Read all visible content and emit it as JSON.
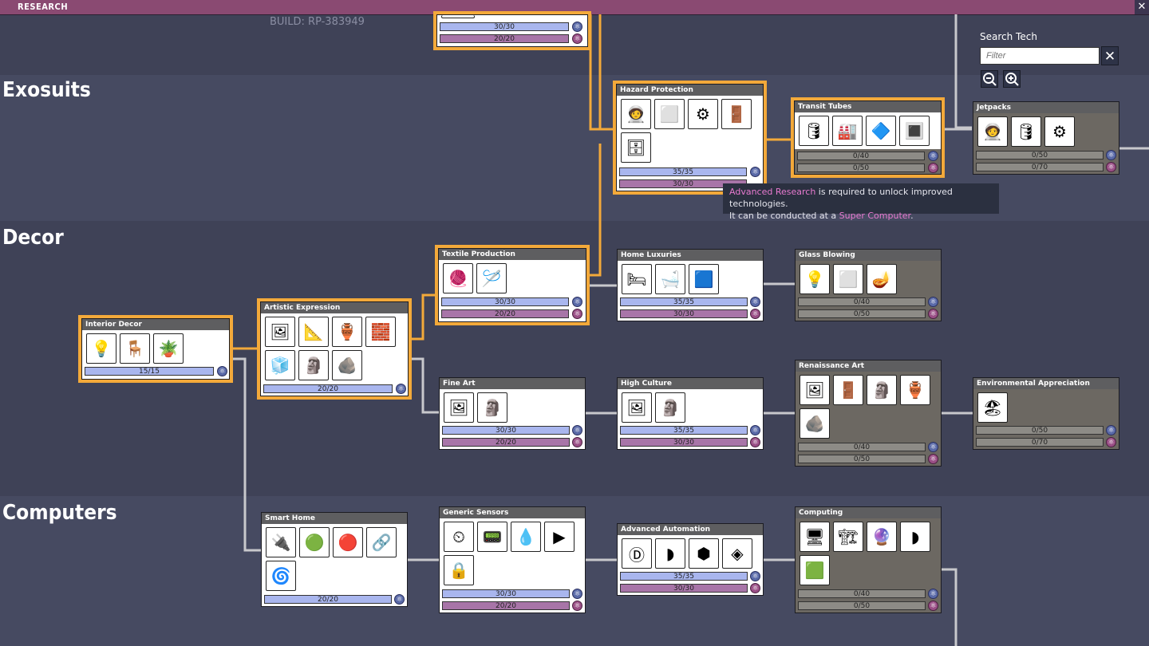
{
  "window": {
    "title": "RESEARCH",
    "close_label": "✕"
  },
  "build": "BUILD: RP-383949",
  "categories": {
    "exosuits": "Exosuits",
    "decor": "Decor",
    "computers": "Computers"
  },
  "search": {
    "title": "Search Tech",
    "placeholder": "Filter",
    "clear_label": "✕"
  },
  "tooltip": {
    "link1": "Advanced Research",
    "text1": " is required to unlock improved technologies.",
    "text2": "It can be conducted at a ",
    "link2": "Super Computer",
    "text3": "."
  },
  "nodes": {
    "top": {
      "title": "",
      "bar1": "30/30",
      "bar2": "20/20"
    },
    "hazard_protection": {
      "title": "Hazard Protection",
      "bar1": "35/35",
      "bar2": "30/30"
    },
    "transit_tubes": {
      "title": "Transit Tubes",
      "bar1": "0/40",
      "bar2": "0/50"
    },
    "jetpacks": {
      "title": "Jetpacks",
      "bar1": "0/50",
      "bar2": "0/70"
    },
    "textile_production": {
      "title": "Textile Production",
      "bar1": "30/30",
      "bar2": "20/20"
    },
    "home_luxuries": {
      "title": "Home Luxuries",
      "bar1": "35/35",
      "bar2": "30/30"
    },
    "glass_blowing": {
      "title": "Glass Blowing",
      "bar1": "0/40",
      "bar2": "0/50"
    },
    "interior_decor": {
      "title": "Interior Decor",
      "bar1": "15/15"
    },
    "artistic_expression": {
      "title": "Artistic Expression",
      "bar1": "20/20"
    },
    "fine_art": {
      "title": "Fine Art",
      "bar1": "30/30",
      "bar2": "20/20"
    },
    "high_culture": {
      "title": "High Culture",
      "bar1": "35/35",
      "bar2": "30/30"
    },
    "renaissance_art": {
      "title": "Renaissance Art",
      "bar1": "0/40",
      "bar2": "0/50"
    },
    "environmental_appreciation": {
      "title": "Environmental Appreciation",
      "bar1": "0/50",
      "bar2": "0/70"
    },
    "smart_home": {
      "title": "Smart Home",
      "bar1": "20/20"
    },
    "generic_sensors": {
      "title": "Generic Sensors",
      "bar1": "30/30",
      "bar2": "20/20"
    },
    "advanced_automation": {
      "title": "Advanced Automation",
      "bar1": "35/35",
      "bar2": "30/30"
    },
    "computing": {
      "title": "Computing",
      "bar1": "0/40",
      "bar2": "0/50"
    }
  },
  "colors": {
    "highlight": "#f3a93a",
    "research_basic": "#a9b6ee",
    "research_advanced": "#a875a8",
    "background": "#3f4257",
    "band": "#464a61"
  }
}
